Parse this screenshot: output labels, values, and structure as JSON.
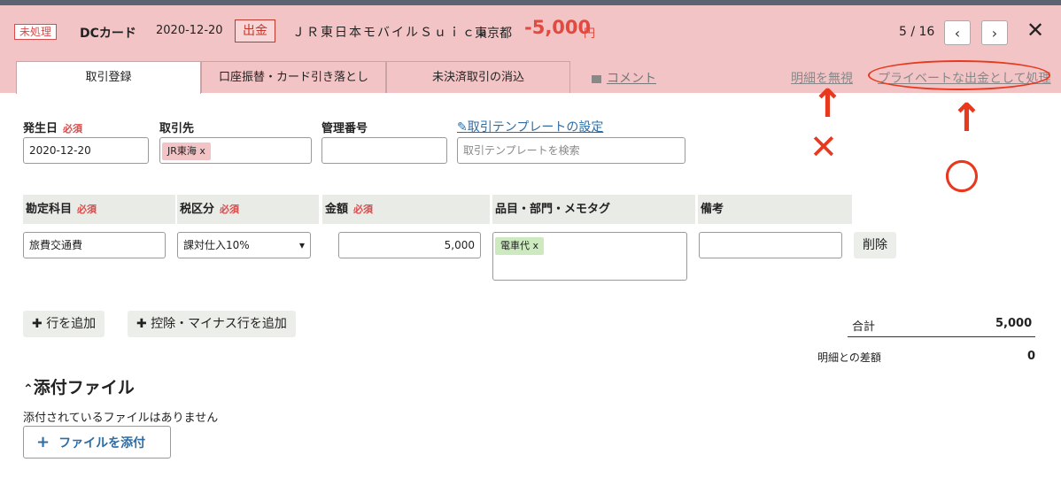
{
  "header": {
    "status_badge": "未処理",
    "card_name": "DCカード",
    "date": "2020-12-20",
    "type_badge": "出金",
    "merchant": "ＪＲ東日本モバイルＳｕｉｃａ",
    "location": "東京都",
    "amount": "-5,000",
    "amount_unit": "円",
    "pager": "5 / 16",
    "prev_icon": "‹",
    "next_icon": "›",
    "close_icon": "✕"
  },
  "tabs": [
    {
      "label": "取引登録"
    },
    {
      "label": "口座振替・カード引き落とし"
    },
    {
      "label": "未決済取引の消込"
    }
  ],
  "links": {
    "comment": "コメント",
    "ignore": "明細を無視",
    "private": "プライベートな出金として処理",
    "template": "取引テンプレートの設定"
  },
  "form": {
    "date_label": "発生日",
    "required": "必須",
    "date_value": "2020-12-20",
    "partner_label": "取引先",
    "partner_tag": "JR東海",
    "tag_remove": "x",
    "ref_label": "管理番号",
    "ref_value": "",
    "template_placeholder": "取引テンプレートを検索"
  },
  "grid": {
    "headers": {
      "account": "勘定科目",
      "tax": "税区分",
      "amount": "金額",
      "items": "品目・部門・メモタグ",
      "note": "備考"
    },
    "row": {
      "account": "旅費交通費",
      "tax": "課対仕入10%",
      "amount": "5,000",
      "items_tag": "電車代",
      "note": "",
      "delete": "削除"
    }
  },
  "actions": {
    "add_row": "行を追加",
    "add_minus_row": "控除・マイナス行を追加"
  },
  "totals": {
    "total_label": "合計",
    "total_value": "5,000",
    "diff_label": "明細との差額",
    "diff_value": "0"
  },
  "attachments": {
    "title": "添付ファイル",
    "empty": "添付されているファイルはありません",
    "add_button": "ファイルを添付"
  },
  "annotations": {
    "bad_mark": "✕",
    "good_mark": "〇",
    "arrow": "↑",
    "color": "#e8391f"
  }
}
